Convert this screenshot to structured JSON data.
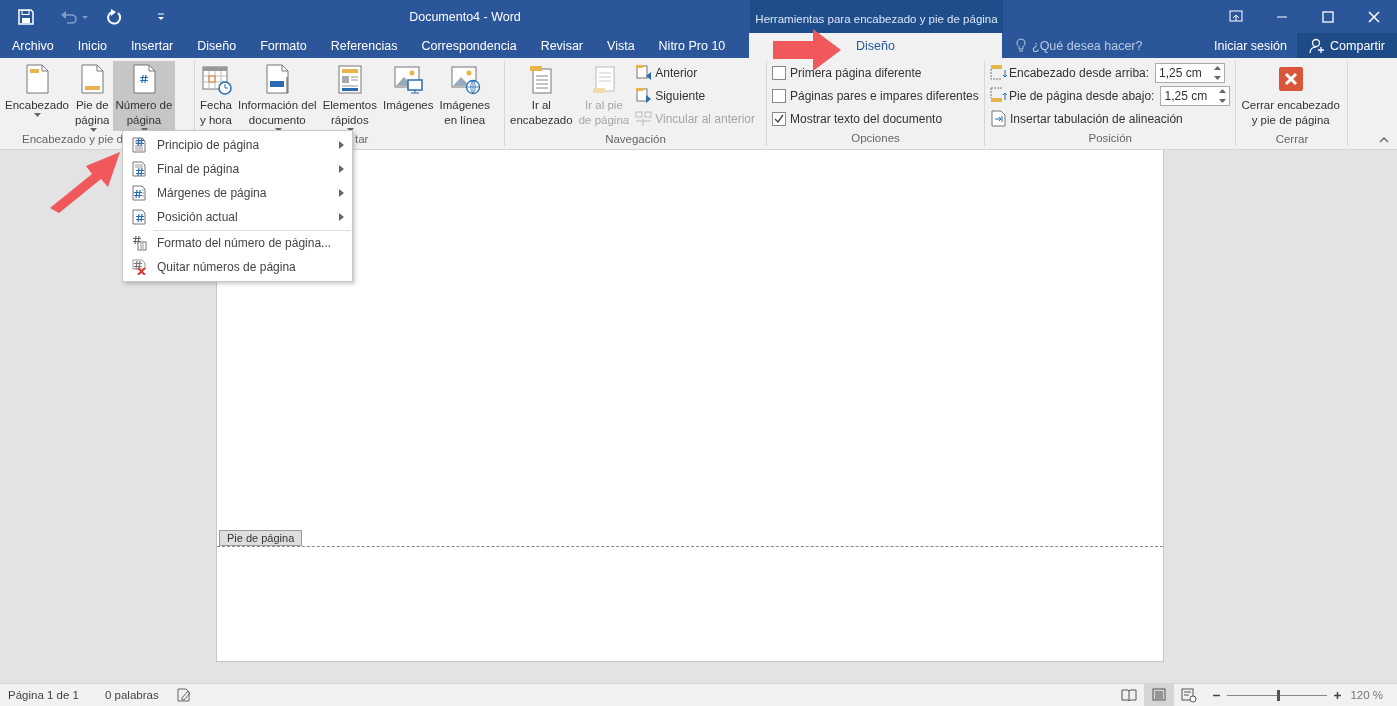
{
  "window": {
    "title": "Documento4 - Word",
    "contextual_title": "Herramientas para encabezado y pie de página"
  },
  "tabs": [
    {
      "label": "Archivo",
      "selected": false,
      "kind": "normal"
    },
    {
      "label": "Inicio",
      "selected": false,
      "kind": "normal"
    },
    {
      "label": "Insertar",
      "selected": false,
      "kind": "normal"
    },
    {
      "label": "Diseño",
      "selected": false,
      "kind": "normal"
    },
    {
      "label": "Formato",
      "selected": false,
      "kind": "normal"
    },
    {
      "label": "Referencias",
      "selected": false,
      "kind": "normal"
    },
    {
      "label": "Correspondencia",
      "selected": false,
      "kind": "normal"
    },
    {
      "label": "Revisar",
      "selected": false,
      "kind": "normal"
    },
    {
      "label": "Vista",
      "selected": false,
      "kind": "normal"
    },
    {
      "label": "Nitro Pro 10",
      "selected": false,
      "kind": "normal"
    },
    {
      "label": "Diseño",
      "selected": true,
      "kind": "contextual"
    }
  ],
  "tell_me": {
    "placeholder": "¿Qué desea hacer?"
  },
  "sign_in": "Iniciar sesión",
  "share": "Compartir",
  "ribbon": [
    {
      "label": "Encabezado y pie d",
      "items": [
        {
          "kind": "large",
          "label": "Encabezado",
          "dropdown": true,
          "disabled": false,
          "pressed": false
        },
        {
          "kind": "large",
          "label": "Pie de\npágina",
          "dropdown": true,
          "disabled": false,
          "pressed": false
        },
        {
          "kind": "large",
          "label": "Número de\npágina",
          "dropdown": true,
          "disabled": false,
          "pressed": true
        }
      ]
    },
    {
      "label": "tar",
      "items": [
        {
          "kind": "large",
          "label": "Fecha\ny hora",
          "dropdown": false,
          "disabled": false,
          "pressed": false
        },
        {
          "kind": "large",
          "label": "Información del\ndocumento",
          "dropdown": true,
          "disabled": false,
          "pressed": false
        },
        {
          "kind": "large",
          "label": "Elementos\nrápidos",
          "dropdown": true,
          "disabled": false,
          "pressed": false
        },
        {
          "kind": "large",
          "label": "Imágenes",
          "dropdown": false,
          "disabled": false,
          "pressed": false
        },
        {
          "kind": "large",
          "label": "Imágenes\nen línea",
          "dropdown": false,
          "disabled": false,
          "pressed": false
        }
      ]
    },
    {
      "label": "Navegación",
      "items": [
        {
          "kind": "large",
          "label": "Ir al\nencabezado",
          "dropdown": false,
          "disabled": false,
          "pressed": false
        },
        {
          "kind": "large",
          "label": "Ir al pie\nde página",
          "dropdown": false,
          "disabled": true,
          "pressed": false
        },
        {
          "kind": "stack",
          "items": [
            {
              "kind": "button",
              "label": "Anterior",
              "disabled": false
            },
            {
              "kind": "button",
              "label": "Siguiente",
              "disabled": false
            },
            {
              "kind": "button",
              "label": "Vincular al anterior",
              "disabled": true
            }
          ]
        }
      ]
    },
    {
      "label": "Opciones",
      "items": [
        {
          "kind": "stack",
          "items": [
            {
              "kind": "checkbox",
              "label": "Primera página diferente",
              "checked": false
            },
            {
              "kind": "checkbox",
              "label": "Páginas pares e impares diferentes",
              "checked": false
            },
            {
              "kind": "checkbox",
              "label": "Mostrar texto del documento",
              "checked": true
            }
          ]
        }
      ]
    },
    {
      "label": "Posición",
      "items": [
        {
          "kind": "stack",
          "items": [
            {
              "kind": "spinner",
              "label": "Encabezado desde arriba:",
              "value": "1,25 cm"
            },
            {
              "kind": "spinner",
              "label": "Pie de página desde abajo:",
              "value": "1,25 cm"
            },
            {
              "kind": "button",
              "label": "Insertar tabulación de alineación",
              "disabled": false
            }
          ]
        }
      ]
    },
    {
      "label": "Cerrar",
      "items": [
        {
          "kind": "large",
          "label": "Cerrar encabezado\ny pie de página",
          "dropdown": false,
          "disabled": false,
          "pressed": false
        }
      ]
    }
  ],
  "menu": [
    {
      "label": "Principio de página",
      "submenu": true,
      "separator_before": false
    },
    {
      "label": "Final de página",
      "submenu": true,
      "separator_before": false
    },
    {
      "label": "Márgenes de página",
      "submenu": true,
      "separator_before": false
    },
    {
      "label": "Posición actual",
      "submenu": true,
      "separator_before": false
    },
    {
      "label": "Formato del número de página...",
      "submenu": false,
      "separator_before": true
    },
    {
      "label": "Quitar números de página",
      "submenu": false,
      "separator_before": false
    }
  ],
  "footer_tag": "Pie de página",
  "status_bar": {
    "page": "Página 1 de 1",
    "words": "0 palabras",
    "views": [
      {
        "kind": "read",
        "selected": false
      },
      {
        "kind": "print",
        "selected": true
      },
      {
        "kind": "web",
        "selected": false
      }
    ],
    "zoom": {
      "level": 0.51,
      "reading": "120 %"
    }
  }
}
